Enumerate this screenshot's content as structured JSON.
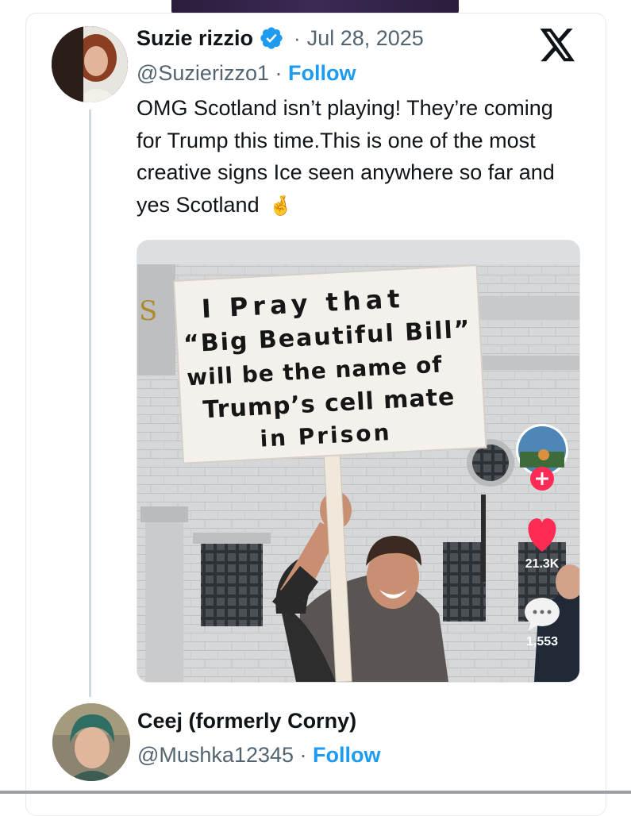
{
  "post": {
    "author_name": "Suzie rizzio",
    "date_separator": "·",
    "date": "Jul 28, 2025",
    "handle": "@Suzierizzo1",
    "handle_separator": " · ",
    "follow_label": "Follow",
    "text": "OMG Scotland isn’t playing! They’re coming for Trump this time.This is one of the most creative signs Ice seen anywhere so far and yes Scotland",
    "emoji": "🤞",
    "icons": {
      "verified": "verified-badge-icon",
      "platform": "x-logo-icon"
    }
  },
  "media": {
    "sign_lines": [
      "I Pray that",
      "“Big Beautiful Bill”",
      "will be the name of",
      "Trump’s cell mate",
      "in Prison"
    ],
    "video_ui": {
      "likes": "21.3K",
      "comments": "1,553",
      "icons": [
        "follow-plus-icon",
        "heart-icon",
        "comment-icon"
      ]
    }
  },
  "reply": {
    "author_name": "Ceej (formerly Corny)",
    "handle": "@Mushka12345",
    "handle_separator": " · ",
    "follow_label": "Follow"
  },
  "colors": {
    "accent": "#1d9bf0",
    "text_primary": "#0f1419",
    "text_secondary": "#536471",
    "like_red": "#fe2c55"
  }
}
